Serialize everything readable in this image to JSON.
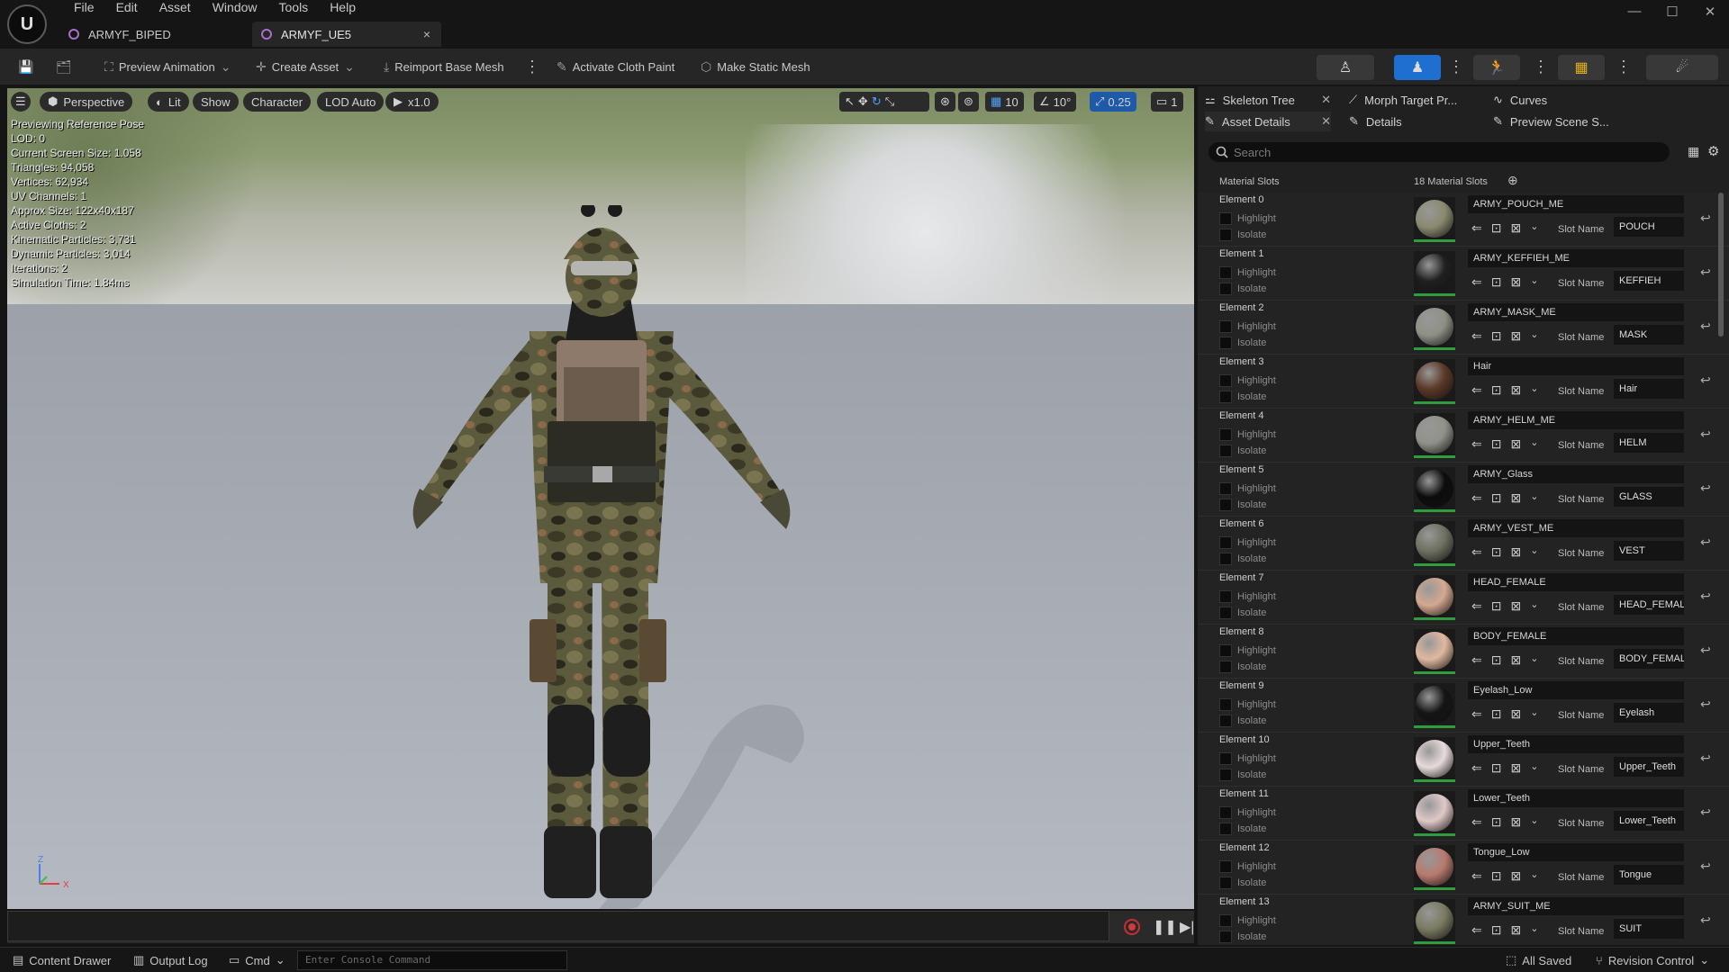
{
  "titlebar": {
    "logo": "U",
    "menus": [
      "File",
      "Edit",
      "Asset",
      "Window",
      "Tools",
      "Help"
    ],
    "tabs": [
      {
        "label": "ARMYF_BIPED"
      },
      {
        "label": "ARMYF_UE5"
      }
    ],
    "tab_close": "×",
    "window_controls": [
      "—",
      "☐",
      "✕"
    ]
  },
  "toolbar": {
    "preview_animation": "Preview Animation",
    "create_asset": "Create Asset",
    "reimport_base_mesh": "Reimport Base Mesh",
    "activate_cloth_paint": "Activate Cloth Paint",
    "make_static_mesh": "Make Static Mesh"
  },
  "viewport": {
    "perspective": "Perspective",
    "lit": "Lit",
    "show": "Show",
    "character": "Character",
    "lod_auto": "LOD Auto",
    "play_speed": "x1.0",
    "grid_value": "10",
    "angle_value": "10°",
    "scale_value": "0.25",
    "camera_speed": "1",
    "stats": [
      "Previewing Reference Pose",
      "LOD: 0",
      "Current Screen Size: 1.058",
      "Triangles: 94,058",
      "Vertices: 62,934",
      "UV Channels: 1",
      "Approx Size: 122x40x187",
      "Active Cloths: 2",
      "Kinematic Particles: 3,731",
      "Dynamic Particles: 3,014",
      "Iterations: 2",
      "Simulation Time: 1.84ms"
    ],
    "axis_z": "Z",
    "axis_x": "X"
  },
  "statusbar": {
    "content_drawer": "Content Drawer",
    "output_log": "Output Log",
    "cmd": "Cmd",
    "console_placeholder": "Enter Console Command",
    "all_saved": "All Saved",
    "revision_control": "Revision Control"
  },
  "panel": {
    "tabs_row1": [
      {
        "label": "Skeleton Tree"
      },
      {
        "label": "Morph Target Pr..."
      },
      {
        "label": "Curves"
      }
    ],
    "tabs_row2": [
      {
        "label": "Asset Details"
      },
      {
        "label": "Details"
      },
      {
        "label": "Preview Scene S..."
      }
    ],
    "search_placeholder": "Search",
    "material_slots_label": "Material Slots",
    "material_slots_count": "18 Material Slots",
    "highlight_label": "Highlight",
    "isolate_label": "Isolate",
    "slot_name_label": "Slot Name",
    "elements": [
      {
        "element": "Element 0",
        "material": "ARMY_POUCH_ME",
        "slot": "POUCH",
        "color": "#8a8a70"
      },
      {
        "element": "Element 1",
        "material": "ARMY_KEFFIEH_ME",
        "slot": "KEFFIEH",
        "color": "#202020"
      },
      {
        "element": "Element 2",
        "material": "ARMY_MASK_ME",
        "slot": "MASK",
        "color": "#8f9086"
      },
      {
        "element": "Element 3",
        "material": "Hair",
        "slot": "Hair",
        "color": "#5a3826"
      },
      {
        "element": "Element 4",
        "material": "ARMY_HELM_ME",
        "slot": "HELM",
        "color": "#90928a"
      },
      {
        "element": "Element 5",
        "material": "ARMY_Glass",
        "slot": "GLASS",
        "color": "#0c0c0c"
      },
      {
        "element": "Element 6",
        "material": "ARMY_VEST_ME",
        "slot": "VEST",
        "color": "#6e7060"
      },
      {
        "element": "Element 7",
        "material": "HEAD_FEMALE",
        "slot": "HEAD_FEMALE",
        "color": "#d4a890"
      },
      {
        "element": "Element 8",
        "material": "BODY_FEMALE",
        "slot": "BODY_FEMALE",
        "color": "#e0b8a0"
      },
      {
        "element": "Element 9",
        "material": "Eyelash_Low",
        "slot": "Eyelash",
        "color": "#151515"
      },
      {
        "element": "Element 10",
        "material": "Upper_Teeth",
        "slot": "Upper_Teeth",
        "color": "#e8dada"
      },
      {
        "element": "Element 11",
        "material": "Lower_Teeth",
        "slot": "Lower_Teeth",
        "color": "#e0c8c8"
      },
      {
        "element": "Element 12",
        "material": "Tongue_Low",
        "slot": "Tongue",
        "color": "#b87a6e"
      },
      {
        "element": "Element 13",
        "material": "ARMY_SUIT_ME",
        "slot": "SUIT",
        "color": "#7a7a62"
      }
    ]
  }
}
